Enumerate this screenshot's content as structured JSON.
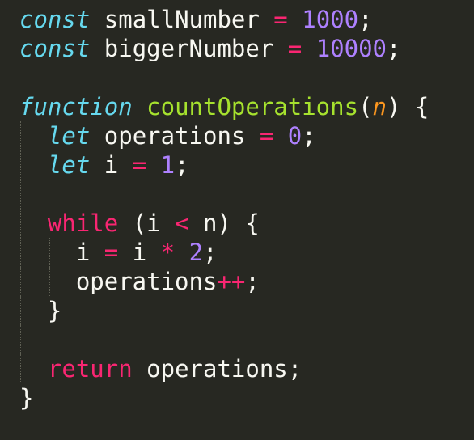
{
  "editor": {
    "theme_colors": {
      "background": "#272822",
      "foreground": "#f8f8f2",
      "storage": "#66d9ef",
      "keyword": "#f92672",
      "number": "#ae81ff",
      "function": "#a6e22e",
      "parameter": "#fd971f"
    },
    "lines": {
      "l1": {
        "kw": "const",
        "name": " smallNumber ",
        "op": "=",
        "sp": " ",
        "num": "1000",
        "end": ";"
      },
      "l2": {
        "kw": "const",
        "name": " biggerNumber ",
        "op": "=",
        "sp": " ",
        "num": "10000",
        "end": ";"
      },
      "l4": {
        "kw": "function",
        "sp": " ",
        "fn": "countOperations",
        "open": "(",
        "param": "n",
        "close": ") {"
      },
      "l5": {
        "indent": "  ",
        "kw": "let",
        "name": " operations ",
        "op": "=",
        "sp": " ",
        "num": "0",
        "end": ";"
      },
      "l6": {
        "indent": "  ",
        "kw": "let",
        "name": " i ",
        "op": "=",
        "sp": " ",
        "num": "1",
        "end": ";"
      },
      "l8": {
        "indent": "  ",
        "kw": "while",
        "a": " (i ",
        "op": "<",
        "b": " n) {"
      },
      "l9": {
        "indent": "    ",
        "a": "i ",
        "op1": "=",
        "b": " i ",
        "op2": "*",
        "sp": " ",
        "num": "2",
        "end": ";"
      },
      "l10": {
        "indent": "    ",
        "name": "operations",
        "op": "++",
        "end": ";"
      },
      "l11": {
        "indent": "  ",
        "text": "}"
      },
      "l13": {
        "indent": "  ",
        "kw": "return",
        "rest": " operations;"
      },
      "l14": {
        "text": "}"
      }
    }
  }
}
